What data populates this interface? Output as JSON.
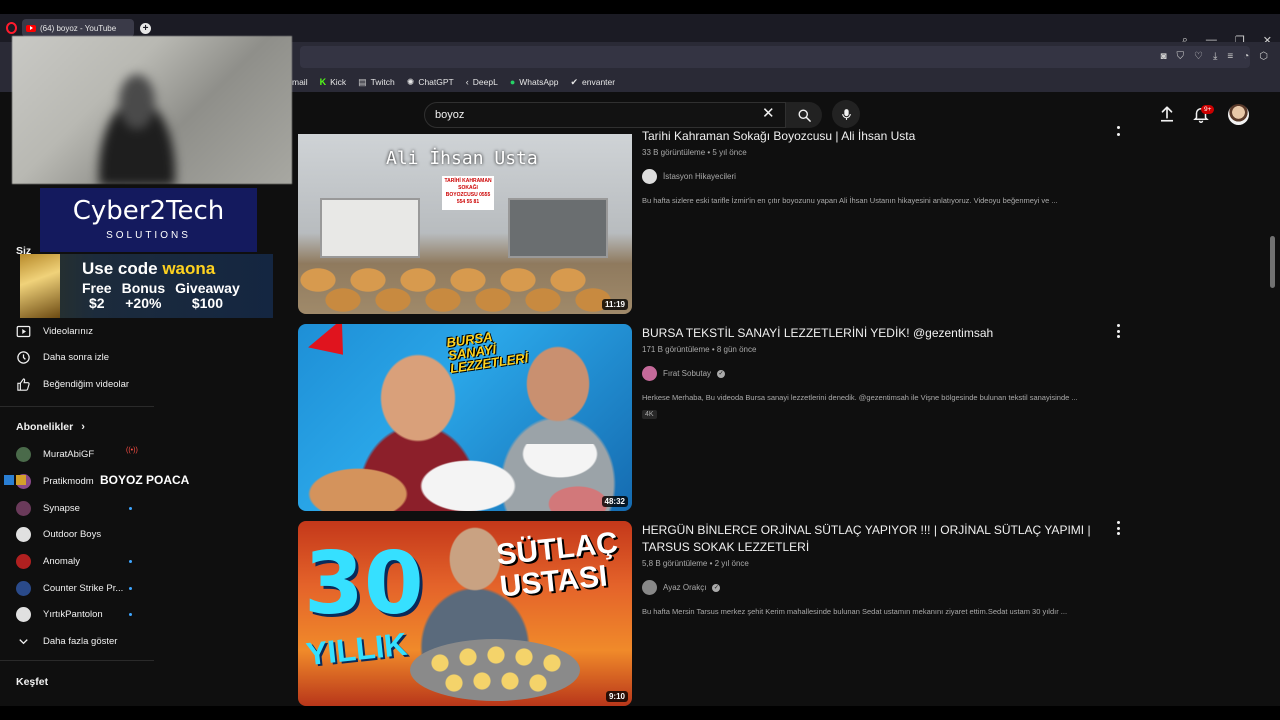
{
  "browser": {
    "tab_title": "(64) boyoz - YouTube",
    "bookmarks": [
      {
        "label": "mail",
        "icon": "mail-icon"
      },
      {
        "label": "Kick",
        "icon": "kick-icon"
      },
      {
        "label": "Twitch",
        "icon": "twitch-icon"
      },
      {
        "label": "ChatGPT",
        "icon": "chatgpt-icon"
      },
      {
        "label": "DeepL",
        "icon": "deepl-icon"
      },
      {
        "label": "WhatsApp",
        "icon": "whatsapp-icon"
      },
      {
        "label": "envanter",
        "icon": "envanter-icon"
      }
    ]
  },
  "header": {
    "search_value": "boyoz",
    "notification_count": "9+"
  },
  "overlays": {
    "sponsor1_title": "Cyber2Tech",
    "sponsor1_sub": "SOLUTIONS",
    "sponsor2_use": "Use code",
    "sponsor2_code": "waona",
    "sponsor2_c1a": "Free",
    "sponsor2_c1b": "$2",
    "sponsor2_c2a": "Bonus",
    "sponsor2_c2b": "+20%",
    "sponsor2_c3a": "Giveaway",
    "sponsor2_c3b": "$100",
    "stream_text": "BOYOZ POACA"
  },
  "sidebar": {
    "you_heading": "Siz",
    "items": [
      {
        "label": "Videolarınız"
      },
      {
        "label": "Daha sonra izle"
      },
      {
        "label": "Beğendiğim videolar"
      }
    ],
    "subs_heading": "Abonelikler",
    "channels": [
      {
        "name": "MuratAbiGF",
        "color": "#4a6a4a"
      },
      {
        "name": "Pratikmodm",
        "color": "#8a4a8a"
      },
      {
        "name": "Synapse",
        "color": "#6a3a5a"
      },
      {
        "name": "Outdoor Boys",
        "color": "#e0e0e0"
      },
      {
        "name": "Anomaly",
        "color": "#b02020"
      },
      {
        "name": "Counter Strike Pr...",
        "color": "#2a4a8a"
      },
      {
        "name": "YırtıkPantolon",
        "color": "#e0e0e0"
      }
    ],
    "show_more": "Daha fazla göster",
    "explore_heading": "Keşfet"
  },
  "videos": [
    {
      "title": "Tarihi Kahraman Sokağı Boyozcusu | Ali İhsan Usta",
      "views": "33 B görüntüleme",
      "age": "5 yıl önce",
      "channel": "İstasyon Hikayecileri",
      "verified": false,
      "description": "Bu hafta sizlere eski tarifle İzmir'in en çıtır boyozunu yapan Ali İhsan Ustanın hikayesini anlatıyoruz. Videoyu beğenmeyi ve ...",
      "duration": "11:19",
      "thumb_caption": "Ali İhsan Usta",
      "thumb_sign": "TARİHİ KAHRAMAN SOKAĞI BOYOZCUSU 0555 554 55 81"
    },
    {
      "title": "BURSA TEKSTİL SANAYİ LEZZETLERİNİ YEDİK! @gezentimsah",
      "views": "171 B görüntüleme",
      "age": "8 gün önce",
      "channel": "Fırat Sobutay",
      "verified": true,
      "description": "Herkese Merhaba, Bu videoda Bursa sanayi lezzetlerini denedik. @gezentimsah ile Vişne bölgesinde bulunan tekstil sanayisinde ...",
      "badge": "4K",
      "duration": "48:32",
      "thumb_caption": "BURSA SANAYİ LEZZETLERİ"
    },
    {
      "title": "HERGÜN BİNLERCE ORJİNAL SÜTLAÇ YAPIYOR !!! | ORJİNAL SÜTLAÇ YAPIMI | TARSUS SOKAK LEZZETLERİ",
      "views": "5,8 B görüntüleme",
      "age": "2 yıl önce",
      "channel": "Ayaz Orakçı",
      "verified": true,
      "description": "Bu hafta Mersin Tarsus merkez şehit Kerim mahallesinde bulunan Sedat ustamın mekanını ziyaret ettim.Sedat ustam 30 yıldır ...",
      "duration": "9:10",
      "thumb_caption_big": "30",
      "thumb_caption_yil": "YILLIK",
      "thumb_caption_right": "SÜTLAÇ USTASI"
    }
  ],
  "colors": {
    "yt_red": "#ff0000",
    "badge_red": "#cc0000",
    "accent_blue": "#3ea6ff"
  }
}
